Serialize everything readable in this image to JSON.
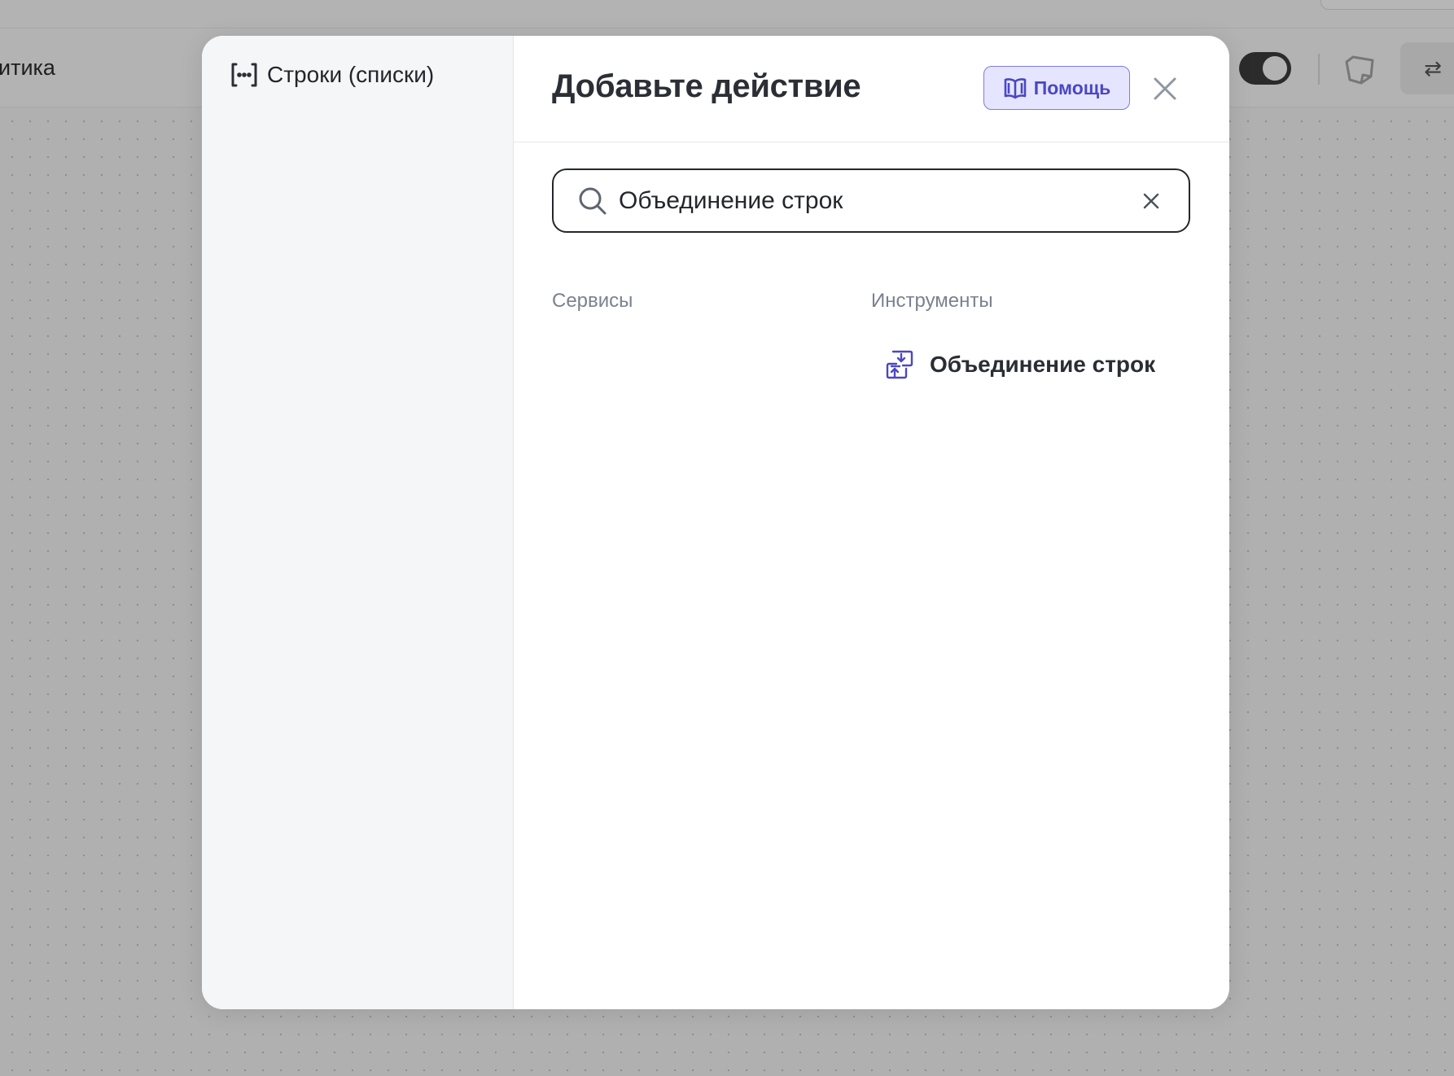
{
  "background": {
    "title_fragment": "итика",
    "toggle_state": "on",
    "swap_symbol": "⇄"
  },
  "sidebar": {
    "items": [
      {
        "label": "Строки (списки)",
        "icon": "brackets-dots-icon"
      }
    ]
  },
  "modal": {
    "title": "Добавьте действие",
    "help_label": "Помощь",
    "help_icon": "book-icon",
    "close_icon": "close-icon"
  },
  "search": {
    "value": "Объединение строк",
    "icon": "search-icon",
    "clear_icon": "clear-icon"
  },
  "columns": {
    "services": "Сервисы",
    "tools": "Инструменты"
  },
  "results": {
    "tools": [
      {
        "label": "Объединение строк",
        "icon": "merge-strings-icon"
      }
    ]
  },
  "colors": {
    "accent": "#4a47c4",
    "accent_bg": "#e6e5ff",
    "text": "#2b2f35",
    "muted": "#7a8190",
    "sidebar_bg": "#f5f6f8",
    "canvas_bg": "#b0b0b0"
  }
}
